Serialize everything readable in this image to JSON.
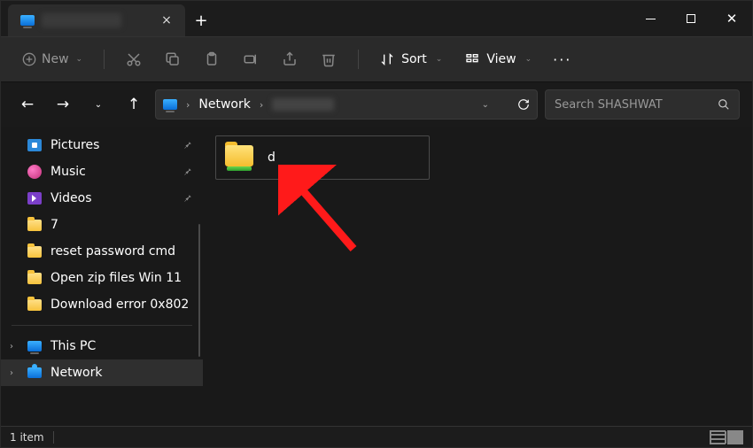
{
  "titlebar": {
    "tab_title": "(redacted)"
  },
  "cmdbar": {
    "new_label": "New",
    "sort_label": "Sort",
    "view_label": "View"
  },
  "address": {
    "root": "Network",
    "leaf": "(redacted)"
  },
  "search": {
    "placeholder": "Search SHASHWAT"
  },
  "sidebar": {
    "quick": [
      {
        "label": "Pictures",
        "icon": "pictures",
        "pinned": true
      },
      {
        "label": "Music",
        "icon": "music",
        "pinned": true
      },
      {
        "label": "Videos",
        "icon": "videos",
        "pinned": true
      },
      {
        "label": "7",
        "icon": "folder",
        "pinned": false
      },
      {
        "label": "reset password cmd",
        "icon": "folder",
        "pinned": false
      },
      {
        "label": "Open zip files Win 11",
        "icon": "folder",
        "pinned": false
      },
      {
        "label": "Download error 0x802",
        "icon": "folder",
        "pinned": false
      }
    ],
    "thispc_label": "This PC",
    "network_label": "Network"
  },
  "main": {
    "items": [
      {
        "label": "d",
        "type": "network-share"
      }
    ]
  },
  "statusbar": {
    "count": "1 item"
  }
}
